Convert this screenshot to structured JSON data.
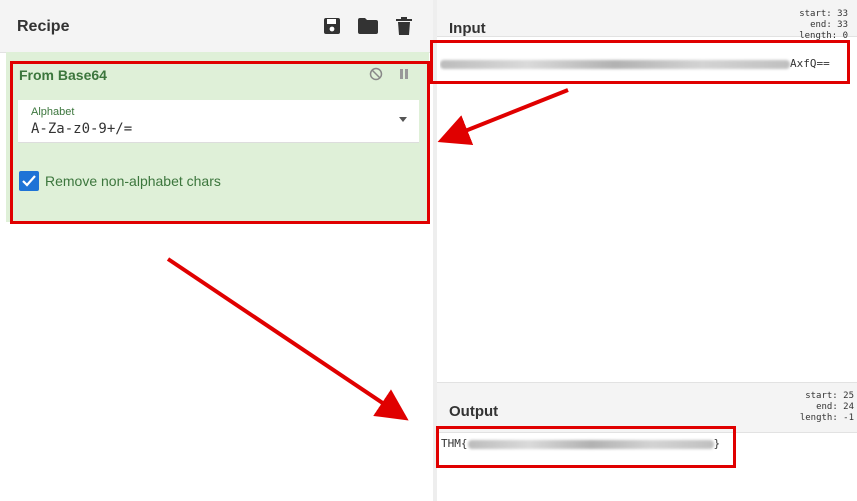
{
  "recipe": {
    "title": "Recipe",
    "toolbar": {
      "save_icon": "save-icon",
      "open_icon": "folder-icon",
      "clear_icon": "trash-icon"
    },
    "operation": {
      "name": "From Base64",
      "alphabet_label": "Alphabet",
      "alphabet_value": "A-Za-z0-9+/=",
      "remove_non_alphabet_label": "Remove non-alphabet chars",
      "remove_non_alphabet_checked": true
    }
  },
  "input": {
    "title": "Input",
    "stats": {
      "start": "start: 33",
      "end": "end: 33",
      "length": "length: 0"
    },
    "text_visible_suffix": "AxfQ=="
  },
  "output": {
    "title": "Output",
    "stats": {
      "start": "start: 25",
      "end": "end: 24",
      "length": "length: -1"
    },
    "text_prefix": "THM{",
    "text_suffix": "}"
  },
  "colors": {
    "operation_bg": "#dff0d8",
    "operation_text": "#3c763d",
    "checkbox": "#1e73d6",
    "annotation": "#e00000"
  }
}
